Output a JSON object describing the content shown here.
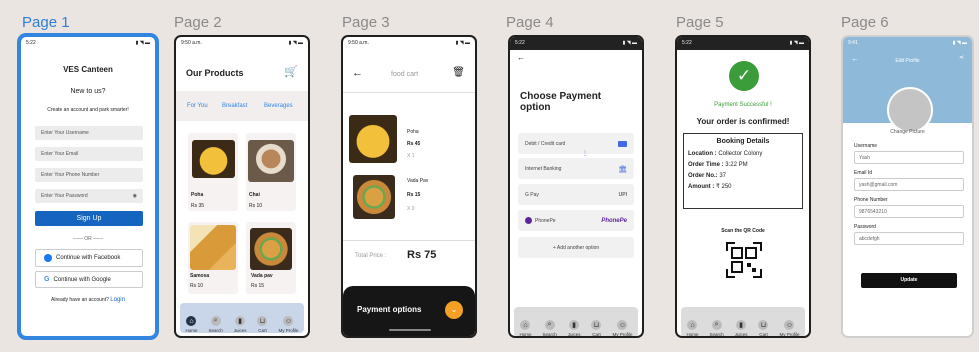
{
  "pages": [
    "Page 1",
    "Page 2",
    "Page 3",
    "Page 4",
    "Page 5",
    "Page 6"
  ],
  "p1": {
    "time": "5:22",
    "title": "VES Canteen",
    "subtitle": "New to us?",
    "tagline": "Create an account and park smarter!",
    "fields": [
      "Enter Your Username",
      "Enter Your Email",
      "Enter Your Phone Number",
      "Enter Your Password"
    ],
    "signup": "Sign Up",
    "or": "OR",
    "facebook": "Continue with Facebook",
    "google": "Continue with Google",
    "have_account": "Already have an account?",
    "login": "Login"
  },
  "p2": {
    "time": "9:50 a.m.",
    "title": "Our Products",
    "tabs": [
      "For You",
      "Breakfast",
      "Beverages"
    ],
    "products": [
      {
        "name": "Poha",
        "price": "Rs 35"
      },
      {
        "name": "Chai",
        "price": "Rs 10"
      },
      {
        "name": "Samosa",
        "price": "Rs 10"
      },
      {
        "name": "Vada pav",
        "price": "Rs 15"
      }
    ]
  },
  "nav": [
    "Home",
    "Search",
    "Juices",
    "Cart",
    "My Profile"
  ],
  "p3": {
    "time": "9:50 a.m.",
    "title": "food cart",
    "items": [
      {
        "name": "Poha",
        "price": "Rs 45",
        "qty": "X 1"
      },
      {
        "name": "Vada Pav",
        "price": "Rs 15",
        "qty": "X 0"
      }
    ],
    "total_label": "Total Price :",
    "total_value": "Rs 75",
    "payment_btn": "Payment options"
  },
  "p4": {
    "time": "5:22",
    "title": "Choose Payment option",
    "options": [
      "Debit / Credit card",
      "Internet Banking",
      "G Pay",
      "PhonePe"
    ],
    "logos": [
      "",
      "",
      "UPI",
      "PhonePe"
    ],
    "add": "+  Add another option"
  },
  "p5": {
    "time": "5:22",
    "success": "Payment Successful !",
    "confirmed": "Your order is confirmed!",
    "details_title": "Booking Details",
    "details": [
      {
        "k": "Location :",
        "v": "Collector Colony"
      },
      {
        "k": "Order Time :",
        "v": "3:22 PM"
      },
      {
        "k": "Order No.:",
        "v": "37"
      },
      {
        "k": "Amount :",
        "v": "₹ 250"
      }
    ],
    "scan": "Scan the QR Code"
  },
  "p6": {
    "time": "9:41",
    "title": "Edit Profile",
    "change_picture": "Change Picture",
    "fields": [
      {
        "label": "Username",
        "value": "Yash"
      },
      {
        "label": "Email Id",
        "value": "yash@gmail.com"
      },
      {
        "label": "Phone Number",
        "value": "9876543210"
      },
      {
        "label": "Password",
        "value": "abcdefgh"
      }
    ],
    "update": "Update"
  },
  "colors": {
    "accent": "#3286e0",
    "signup_blue": "#1565c0",
    "success_green": "#3a9d3a",
    "profile_header": "#8fb9d8",
    "pay_orange": "#f4a024"
  }
}
